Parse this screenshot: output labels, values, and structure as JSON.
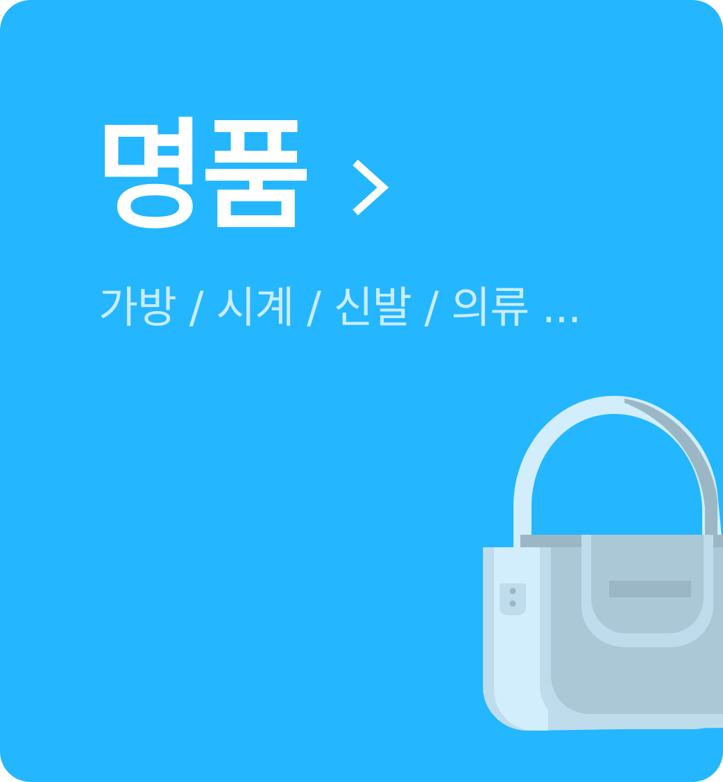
{
  "card": {
    "title": "명품",
    "subtitle": "가방 / 시계 / 신발 / 의류 ...",
    "background_color": "#24b6ff",
    "title_color": "#ffffff",
    "subtitle_color": "#c9ecfd"
  },
  "icons": {
    "arrow": "chevron-right-icon",
    "illustration": "handbag-icon"
  }
}
